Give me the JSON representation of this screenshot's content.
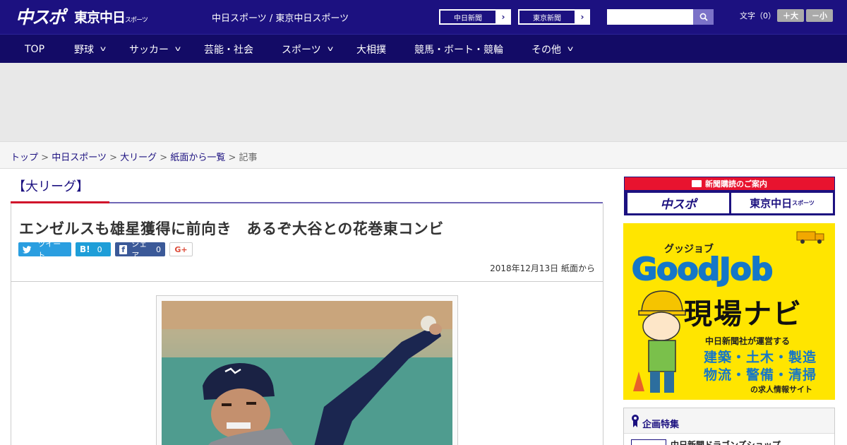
{
  "header": {
    "logo_main": "中スポ",
    "logo_sub": "東京中日",
    "logo_sub_small": "スポーツ",
    "site_title": "中日スポーツ / 東京中日スポーツ",
    "ext_links": [
      "中日新聞",
      "東京新聞"
    ],
    "search_placeholder": "",
    "fontsize_label": "文字（0）",
    "fontsize_up": "＋大",
    "fontsize_down": "－小"
  },
  "nav": {
    "items": [
      {
        "label": "TOP",
        "has_menu": false
      },
      {
        "label": "野球",
        "has_menu": true
      },
      {
        "label": "サッカー",
        "has_menu": true
      },
      {
        "label": "芸能・社会",
        "has_menu": false
      },
      {
        "label": "スポーツ",
        "has_menu": true
      },
      {
        "label": "大相撲",
        "has_menu": false
      },
      {
        "label": "競馬・ボート・競輪",
        "has_menu": false
      },
      {
        "label": "その他",
        "has_menu": true
      }
    ]
  },
  "breadcrumb": {
    "items": [
      "トップ",
      "中日スポーツ",
      "大リーグ",
      "紙面から一覧"
    ],
    "current": "記事",
    "separator": ">"
  },
  "article": {
    "category": "【大リーグ】",
    "headline": "エンゼルスも雄星獲得に前向き　あるぞ大谷との花巻東コンビ",
    "share": {
      "tweet": "ツイート",
      "hatena_count": "0",
      "facebook": "シェア",
      "facebook_count": "0",
      "gplus": "G+"
    },
    "date": "2018年12月13日 紙面から"
  },
  "sidebar": {
    "subscribe_top": "新聞購読のご案内",
    "subscribe_left": "中スポ",
    "subscribe_right": "東京中日",
    "subscribe_right_small": "スポーツ",
    "goodjob_kana": "グッジョブ",
    "goodjob_title": "GoodJob",
    "goodjob_navi": "現場ナビ",
    "goodjob_operator": "中日新聞社が運営する",
    "goodjob_line1": "建築・土木・製造",
    "goodjob_line2": "物流・警備・清掃",
    "goodjob_site": "の求人情報サイト",
    "feature_title": "企画特集",
    "feature_item": "中日新聞ドラゴンズショップ"
  },
  "colors": {
    "brand": "#1c1180",
    "nav": "#130b66",
    "accent_red": "#d0102a",
    "goodjob_yellow": "#ffe500",
    "goodjob_blue": "#1577c8"
  }
}
